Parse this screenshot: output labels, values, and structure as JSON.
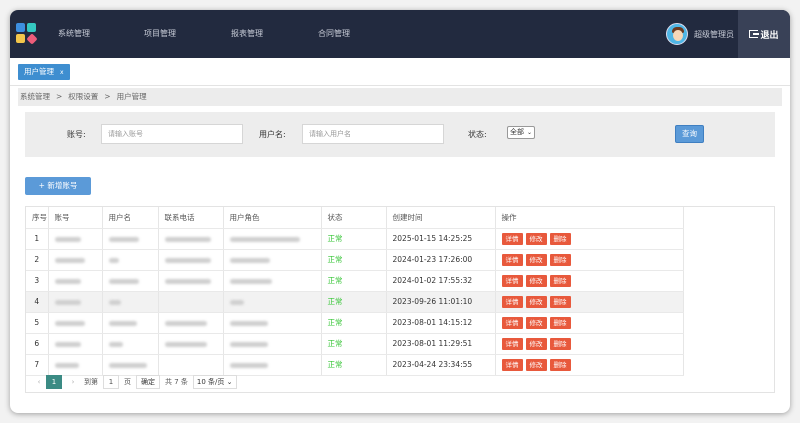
{
  "nav": {
    "items": [
      "系统管理",
      "项目管理",
      "报表管理",
      "合同管理"
    ],
    "user_name": "超级管理员",
    "logout_label": "退出"
  },
  "colors": {
    "nav_bg": "#222a3f",
    "primary": "#5b9ad8",
    "danger": "#e8593c",
    "ok": "#35c535"
  },
  "tab": {
    "label": "用户管理",
    "close": "x"
  },
  "breadcrumb": [
    "系统管理",
    "权限设置",
    "用户管理"
  ],
  "breadcrumb_sep": ">",
  "search": {
    "account_label": "账号:",
    "account_placeholder": "请输入账号",
    "username_label": "用户名:",
    "username_placeholder": "请输入用户名",
    "status_label": "状态:",
    "status_value": "全部",
    "query_label": "查询"
  },
  "add_button": "+ 新增账号",
  "table": {
    "headers": [
      "序号",
      "账号",
      "用户名",
      "联系电话",
      "用户角色",
      "状态",
      "创建时间",
      "操作"
    ],
    "rows": [
      {
        "no": "1",
        "status": "正常",
        "created": "2025-01-15 14:25:25"
      },
      {
        "no": "2",
        "status": "正常",
        "created": "2024-01-23 17:26:00"
      },
      {
        "no": "3",
        "status": "正常",
        "created": "2024-01-02 17:55:32"
      },
      {
        "no": "4",
        "status": "正常",
        "created": "2023-09-26 11:01:10"
      },
      {
        "no": "5",
        "status": "正常",
        "created": "2023-08-01 14:15:12"
      },
      {
        "no": "6",
        "status": "正常",
        "created": "2023-08-01 11:29:51"
      },
      {
        "no": "7",
        "status": "正常",
        "created": "2023-04-24 23:34:55"
      }
    ],
    "actions": [
      "详情",
      "修改",
      "删除"
    ]
  },
  "pager": {
    "prev": "‹",
    "current": "1",
    "next": "›",
    "goto_label": "到第",
    "goto_value": "1",
    "page_label": "页",
    "confirm": "确定",
    "total": "共 7 条",
    "page_size": "10 条/页"
  }
}
